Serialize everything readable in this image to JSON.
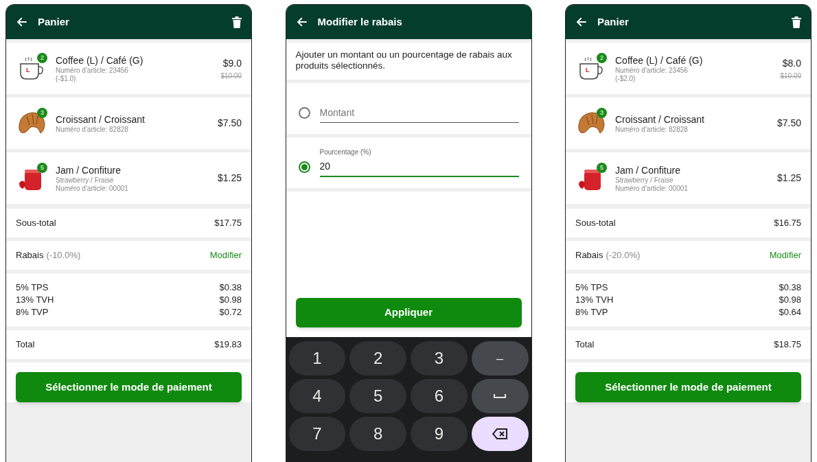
{
  "screens": [
    {
      "kind": "cart",
      "title": "Panier",
      "items": [
        {
          "kind": "cup",
          "image_text": "L",
          "qty": "2",
          "name": "Coffee (L) / Café (G)",
          "details": [
            "Numéro d'article: 23456",
            "(-$1.0)"
          ],
          "price": "$9.0",
          "old_price": "$10.00"
        },
        {
          "kind": "croissant",
          "qty": "3",
          "name": "Croissant / Croissant",
          "details": [
            "Numéro d'article: 82828"
          ],
          "price": "$7.50"
        },
        {
          "kind": "jam",
          "qty": "5",
          "name": "Jam / Confiture",
          "details": [
            "Strawberry / Fraise",
            "Numéro d'article: 00001"
          ],
          "price": "$1.25"
        }
      ],
      "subtotal": {
        "label": "Sous-total",
        "value": "$17.75"
      },
      "discount": {
        "label": "Rabais",
        "amount": "(-10.0%)",
        "action": "Modifier"
      },
      "taxes": [
        {
          "label": "5% TPS",
          "value": "$0.38"
        },
        {
          "label": "13% TVH",
          "value": "$0.98"
        },
        {
          "label": "8% TVP",
          "value": "$0.72"
        }
      ],
      "total": {
        "label": "Total",
        "value": "$19.83"
      },
      "pay_button": "Sélectionner le mode de paiement"
    },
    {
      "kind": "discount",
      "title": "Modifier le rabais",
      "description": "Ajouter un montant ou un pourcentage de rabais aux produits sélectionnés.",
      "options": [
        {
          "placeholder": "Montant",
          "selected": false
        },
        {
          "label": "Pourcentage (%)",
          "value": "20",
          "selected": true
        }
      ],
      "apply_button": "Appliquer",
      "keys": [
        {
          "kind": "digit",
          "label": "1"
        },
        {
          "kind": "digit",
          "label": "2"
        },
        {
          "kind": "digit",
          "label": "3"
        },
        {
          "kind": "symbol",
          "label": "–"
        },
        {
          "kind": "digit",
          "label": "4"
        },
        {
          "kind": "digit",
          "label": "5"
        },
        {
          "kind": "digit",
          "label": "6"
        },
        {
          "kind": "space"
        },
        {
          "kind": "digit",
          "label": "7"
        },
        {
          "kind": "digit",
          "label": "8"
        },
        {
          "kind": "digit",
          "label": "9"
        },
        {
          "kind": "backspace"
        }
      ]
    },
    {
      "kind": "cart",
      "title": "Panier",
      "items": [
        {
          "kind": "cup",
          "image_text": "L",
          "qty": "2",
          "name": "Coffee (L) / Café (G)",
          "details": [
            "Numéro d'article: 23456",
            "(-$2.0)"
          ],
          "price": "$8.0",
          "old_price": "$10.00"
        },
        {
          "kind": "croissant",
          "qty": "3",
          "name": "Croissant / Croissant",
          "details": [
            "Numéro d'article: 82828"
          ],
          "price": "$7.50"
        },
        {
          "kind": "jam",
          "qty": "5",
          "name": "Jam / Confiture",
          "details": [
            "Strawberry / Fraise",
            "Numéro d'article: 00001"
          ],
          "price": "$1.25"
        }
      ],
      "subtotal": {
        "label": "Sous-total",
        "value": "$16.75"
      },
      "discount": {
        "label": "Rabais",
        "amount": "(-20.0%)",
        "action": "Modifier"
      },
      "taxes": [
        {
          "label": "5% TPS",
          "value": "$0.38"
        },
        {
          "label": "13% TVH",
          "value": "$0.98"
        },
        {
          "label": "8% TVP",
          "value": "$0.64"
        }
      ],
      "total": {
        "label": "Total",
        "value": "$18.75"
      },
      "pay_button": "Sélectionner le mode de paiement"
    }
  ]
}
